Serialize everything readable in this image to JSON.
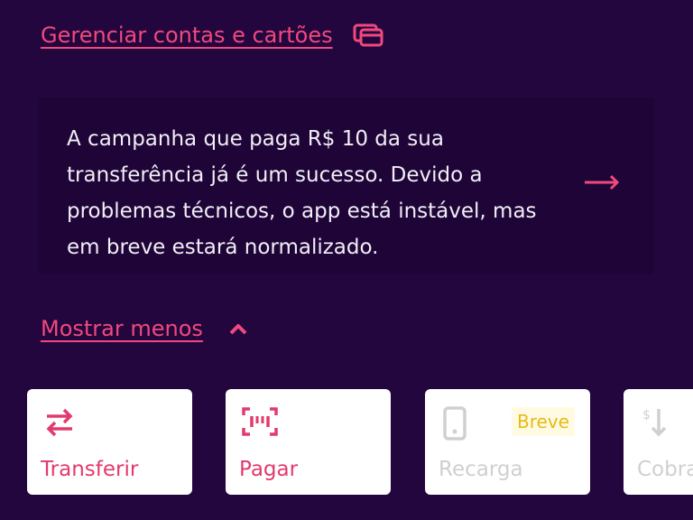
{
  "accounts": {
    "manage_link": "Gerenciar contas e cartões",
    "manage_icon": "cards-icon"
  },
  "notice": {
    "text": "A campanha que paga R$ 10 da sua transferência já é um sucesso. Devido a problemas técnicos, o app está instável, mas em breve estará normalizado.",
    "arrow_icon": "arrow-right-icon"
  },
  "toggle": {
    "label": "Mostrar menos",
    "icon": "chevron-up-icon"
  },
  "actions": [
    {
      "label": "Transferir",
      "icon": "transfer-arrows-icon",
      "enabled": true
    },
    {
      "label": "Pagar",
      "icon": "barcode-scan-icon",
      "enabled": true
    },
    {
      "label": "Recarga",
      "icon": "phone-icon",
      "enabled": false,
      "badge": "Breve"
    },
    {
      "label": "Cobrar",
      "icon": "charge-dollar-icon",
      "enabled": false
    }
  ],
  "colors": {
    "background": "#23063e",
    "accent": "#f0497e",
    "notice_bg": "#1f0537",
    "badge_text": "#e8b916",
    "badge_bg": "#fffbe3",
    "disabled": "#d0d0d0"
  }
}
